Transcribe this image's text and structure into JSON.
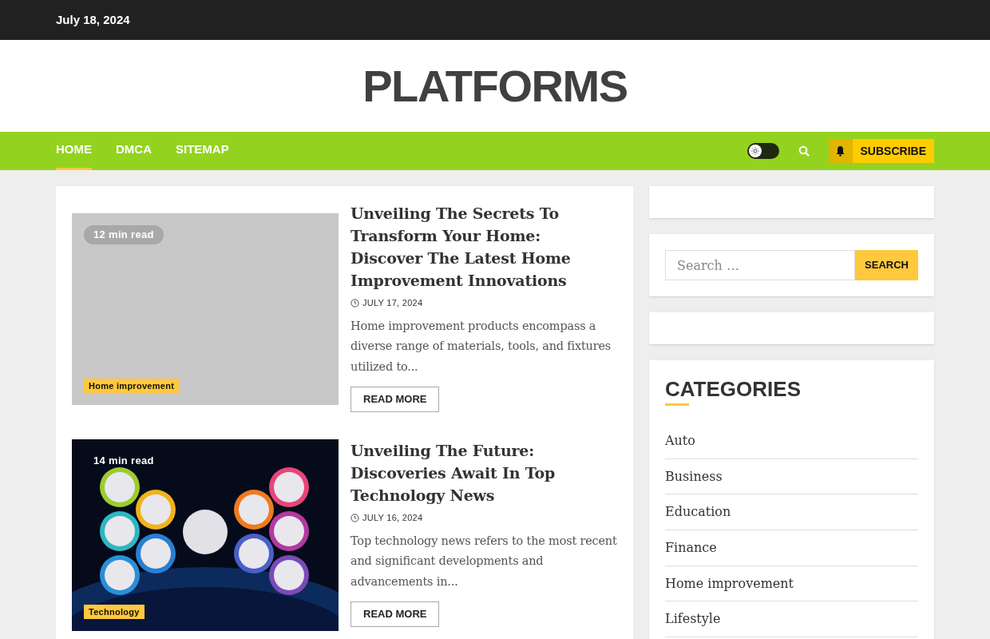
{
  "top_bar": {
    "date": "July 18, 2024"
  },
  "site_title": "PLATFORMS",
  "nav": {
    "items": [
      {
        "label": "HOME",
        "selected": true
      },
      {
        "label": "DMCA",
        "selected": false
      },
      {
        "label": "SITEMAP",
        "selected": false
      }
    ],
    "dark_mode": {
      "on": false
    },
    "subscribe": "SUBSCRIBE"
  },
  "posts": [
    {
      "image": {
        "kind": "placeholder"
      },
      "read_time": "12 min read",
      "category": "Home improvement",
      "title": "Unveiling The Secrets To Transform Your Home: Discover The Latest Home Improvement Innovations",
      "date": "JULY 17, 2024",
      "excerpt": "Home improvement products encompass a diverse range of materials, tools, and fixtures utilized to...",
      "button": "READ MORE"
    },
    {
      "read_time": "14 min read",
      "category": "Technology",
      "title": "Unveiling The Future: Discoveries Await In Top Technology News",
      "date": "JULY 16, 2024",
      "excerpt": "Top technology news refers to the most recent and significant developments and advancements in...",
      "button": "READ MORE"
    }
  ],
  "sidebar": {
    "search": {
      "placeholder": "Search …",
      "button": "SEARCH"
    },
    "categories": {
      "title": "CATEGORIES",
      "items": [
        "Auto",
        "Business",
        "Education",
        "Finance",
        "Home improvement",
        "Lifestyle"
      ]
    }
  }
}
